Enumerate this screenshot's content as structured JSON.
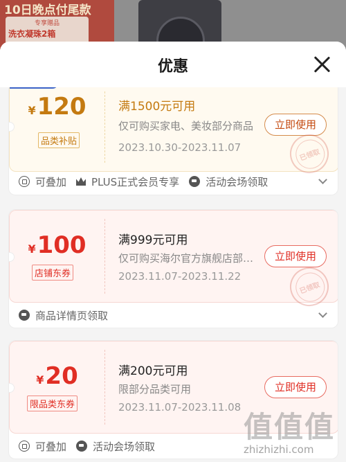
{
  "background": {
    "banner_line1": "10日晚点付尾款",
    "banner_small": "专享赠品",
    "banner_big": "洗衣凝珠2箱"
  },
  "sheet": {
    "title": "优惠"
  },
  "coupons": [
    {
      "currency": "¥",
      "amount": "120",
      "tag": "品类补贴",
      "condition": "满1500元可用",
      "description": "仅可购买家电、美妆部分商品",
      "date_range": "2023.10.30-2023.11.07",
      "button_label": "立即使用",
      "stamp_text": "已领取",
      "meta": [
        "可叠加",
        "PLUS正式会员专享",
        "活动会场领取"
      ]
    },
    {
      "currency": "¥",
      "amount": "100",
      "tag": "店铺东券",
      "condition": "满999元可用",
      "description": "仅可购买海尔官方旗舰店部分商品",
      "date_range": "2023.11.07-2023.11.22",
      "button_label": "立即使用",
      "stamp_text": "已领取",
      "meta": [
        "商品详情页领取"
      ]
    },
    {
      "currency": "¥",
      "amount": "20",
      "tag": "限品类东券",
      "condition": "满200元可用",
      "description": "限部分品类可用",
      "date_range": "2023.11.07-2023.11.08",
      "button_label": "立即使用",
      "meta": [
        "可叠加",
        "活动会场领取"
      ]
    }
  ],
  "watermark": {
    "logo_text": "值值值",
    "url": "zhizhizhi.com"
  },
  "colors": {
    "gold_accent": "#c47a10",
    "red_accent": "#e02e24",
    "sheet_bg": "#f4f4f4"
  }
}
